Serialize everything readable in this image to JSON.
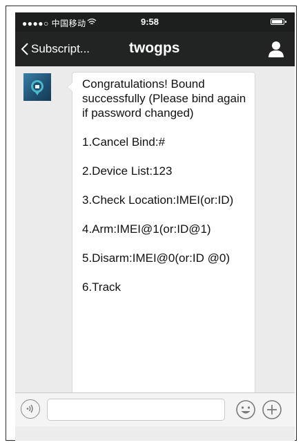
{
  "status_bar": {
    "carrier": "●●●●○ 中国移动",
    "time": "9:58"
  },
  "nav": {
    "back_label": "Subscript...",
    "title": "twogps"
  },
  "message": {
    "lines": [
      "Congratulations! Bound successfully (Please bind again if password changed)",
      "1.Cancel Bind:#",
      "2.Device List:123",
      "3.Check Location:IMEI(or:ID)",
      "4.Arm:IMEI@1(or:ID@1)",
      "5.Disarm:IMEI@0(or:ID @0)",
      "6.Track"
    ]
  },
  "input_bar": {
    "text_value": ""
  },
  "icons": {
    "back": "chevron-left-icon",
    "profile": "person-icon",
    "voice": "voice-icon",
    "emoji": "emoji-icon",
    "plus": "plus-icon",
    "wifi": "wifi-icon",
    "battery": "battery-icon"
  },
  "colors": {
    "nav_background": "#222423",
    "chat_background": "#ebebeb",
    "bubble_background": "#ffffff"
  }
}
